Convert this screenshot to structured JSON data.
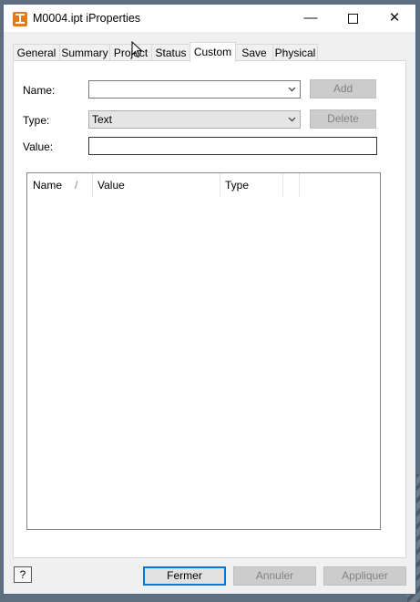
{
  "window": {
    "title": "M0004.ipt iProperties"
  },
  "tabs": [
    {
      "label": "General"
    },
    {
      "label": "Summary"
    },
    {
      "label": "Project"
    },
    {
      "label": "Status"
    },
    {
      "label": "Custom",
      "active": true
    },
    {
      "label": "Save"
    },
    {
      "label": "Physical"
    }
  ],
  "form": {
    "name_label": "Name:",
    "name_value": "",
    "type_label": "Type:",
    "type_value": "Text",
    "value_label": "Value:",
    "value_value": "",
    "add_label": "Add",
    "delete_label": "Delete"
  },
  "table": {
    "columns": [
      "Name",
      "Value",
      "Type"
    ],
    "sort_glyph": "/",
    "rows": []
  },
  "footer": {
    "help_label": "?",
    "close_label": "Fermer",
    "cancel_label": "Annuler",
    "apply_label": "Appliquer"
  },
  "icons": [
    "app-icon",
    "minimize-icon",
    "maximize-icon",
    "close-icon",
    "chevron-down-icon",
    "help-icon",
    "cursor-icon"
  ]
}
